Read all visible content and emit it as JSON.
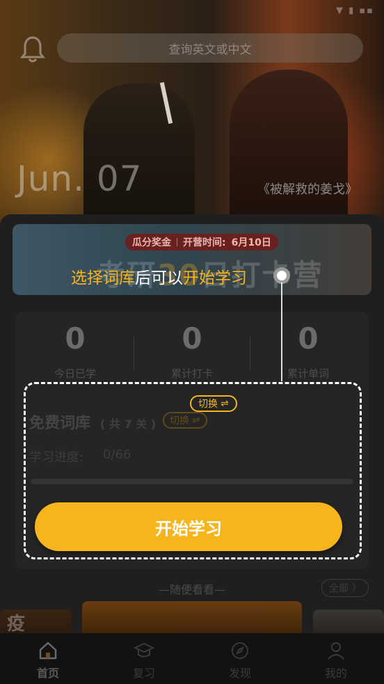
{
  "header": {
    "search_placeholder": "查询英文或中文"
  },
  "hero": {
    "date": "Jun. 07",
    "movie": "《被解救的姜戈》"
  },
  "banner": {
    "tag_left": "瓜分奖金",
    "tag_mid": "开营时间:",
    "tag_date": "6月10日",
    "headline_pre": "考研",
    "headline_num": "30",
    "headline_post": "日打卡营"
  },
  "tooltip": {
    "part1": "选择词库",
    "part2": "后可以",
    "part3": "开始学习"
  },
  "stats": [
    {
      "value": "0",
      "label": "今日已学"
    },
    {
      "value": "0",
      "label": "累计打卡"
    },
    {
      "value": "0",
      "label": "累计单词"
    }
  ],
  "library": {
    "title": "免费词库",
    "count": "( 共 7 关 )",
    "switch_label": "切换",
    "switch_glyph": "⇌",
    "progress_label": "学习进度:",
    "progress_value": "0/66",
    "progress_fraction": 0
  },
  "start_button": "开始学习",
  "section": {
    "title": "—随便看看—",
    "all_label": "全部 〉"
  },
  "thumbs": {
    "first_mark": "疫"
  },
  "nav": [
    {
      "label": "首页",
      "icon": "home-icon",
      "active": true
    },
    {
      "label": "复习",
      "icon": "graduation-cap-icon",
      "active": false
    },
    {
      "label": "发现",
      "icon": "compass-icon",
      "active": false
    },
    {
      "label": "我的",
      "icon": "user-icon",
      "active": false
    }
  ],
  "colors": {
    "accent": "#f6b51c",
    "overlay_text": "#ffffff"
  }
}
